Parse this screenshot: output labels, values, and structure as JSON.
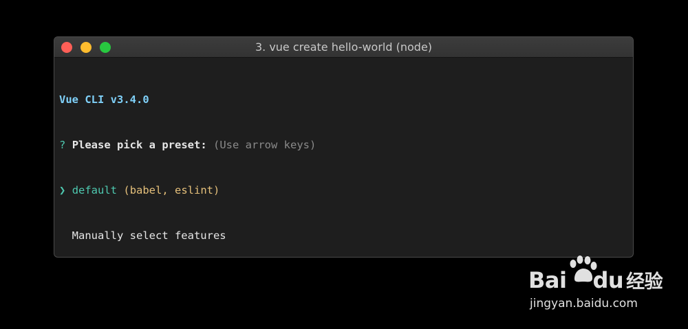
{
  "window": {
    "title": "3. vue create hello-world (node)",
    "controls": [
      {
        "name": "close-button",
        "color": "#ff5f57"
      },
      {
        "name": "minimize-button",
        "color": "#febc2e"
      },
      {
        "name": "zoom-button",
        "color": "#28c840"
      }
    ]
  },
  "terminal": {
    "version_line": "Vue CLI v3.4.0",
    "prompt": {
      "mark": "?",
      "question": "Please pick a preset:",
      "hint": "(Use arrow keys)"
    },
    "options": [
      {
        "pointer": "❯",
        "label": "default",
        "detail": "(babel, eslint)",
        "selected": true
      },
      {
        "pointer": "",
        "label": "Manually select features",
        "detail": "",
        "selected": false
      }
    ]
  },
  "watermark": {
    "brand": "Bai",
    "brand_tail": "du",
    "brand_cn": "经验",
    "url": "jingyan.baidu.com"
  },
  "colors": {
    "version": "#7fd0f8",
    "prompt_mark": "#4ec9b0",
    "selected": "#4ec9b0",
    "detail": "#e5c07b",
    "terminal_bg": "#1e1e1e"
  }
}
